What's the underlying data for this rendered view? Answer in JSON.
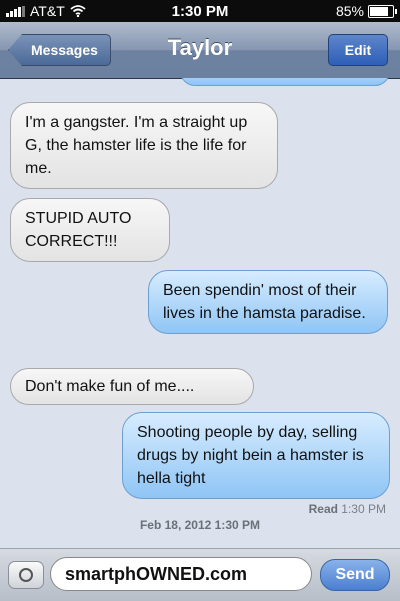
{
  "status_bar": {
    "carrier": "AT&T",
    "time": "1:30 PM",
    "battery_text": "85%",
    "battery_level": 0.85
  },
  "nav": {
    "back_label": "Messages",
    "title": "Taylor",
    "edit_label": "Edit"
  },
  "messages": [
    {
      "from": "contact",
      "text": "I'm a gangster. I'm a straight up G, the hamster life is the life for me."
    },
    {
      "from": "contact",
      "text": "STUPID AUTO CORRECT!!!"
    },
    {
      "from": "me",
      "text": "Been spendin' most of their lives in the hamsta paradise."
    },
    {
      "from": "contact",
      "text": "Don't make fun of me...."
    },
    {
      "from": "me",
      "text": "Shooting people by day, selling drugs by night bein a hamster is hella tight"
    }
  ],
  "read_receipt": {
    "label": "Read",
    "time": "1:30 PM"
  },
  "timestamp": "Feb 18, 2012 1:30 PM",
  "composer": {
    "input_value": "smartphOWNED.com",
    "send_label": "Send"
  },
  "colors": {
    "sent_bubble": "#a8d3fa",
    "received_bubble": "#ececec",
    "nav_bar": "#7d8fab"
  }
}
